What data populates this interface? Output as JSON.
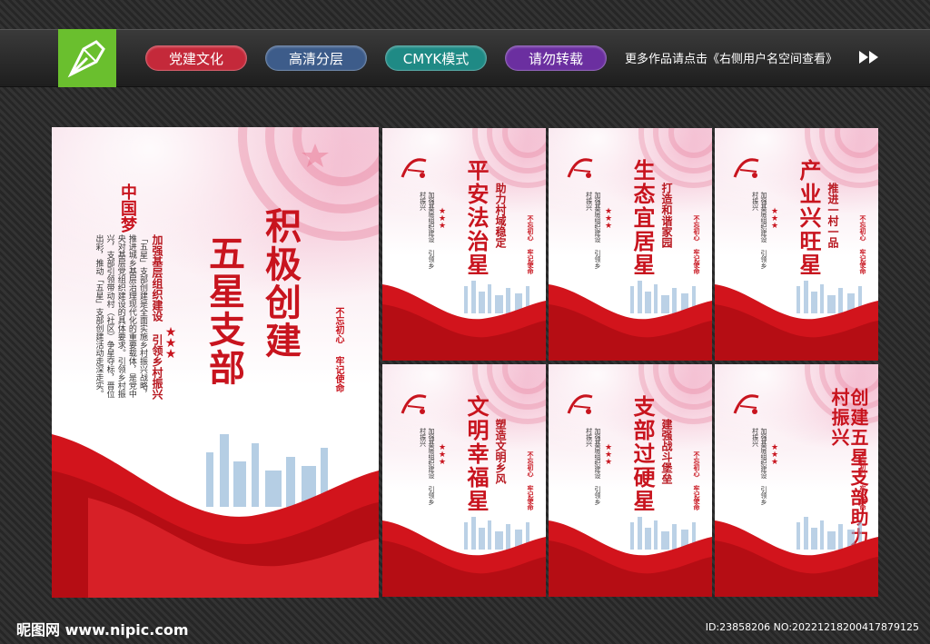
{
  "toolbar": {
    "tags": [
      {
        "label": "党建文化",
        "color": "#c4293a"
      },
      {
        "label": "高清分层",
        "color": "#3d5c8a"
      },
      {
        "label": "CMYK模式",
        "color": "#1f8a85"
      },
      {
        "label": "请勿转载",
        "color": "#6b2fa0"
      }
    ],
    "more_text": "更多作品请点击《右侧用户名空间查看》"
  },
  "colors": {
    "accent": "#c8141e",
    "logo_green": "#6abf2e"
  },
  "main_poster": {
    "logo_text": "中国梦",
    "title_line1": "积极创建",
    "title_line2": "五星支部",
    "sub_title": "加强基层组织建设 引领乡村振兴",
    "body": "「五星」支部创建是全面实施乡村振兴战略，推进城乡基层治理现代化的重要载体，是党中央对基层党组织建设的具体要求。引领乡村振兴，支部引领带动村（社区）争星夺标，晋位出彩，推动「五星」支部创建活动走深走实。",
    "stamp1": "不忘初心",
    "stamp2": "牢记使命"
  },
  "small_posters": [
    {
      "title": "平安法治星",
      "subtitle": "助力村域稳定"
    },
    {
      "title": "生态宜居星",
      "subtitle": "打造和谐家园"
    },
    {
      "title": "产业兴旺星",
      "subtitle": "推进一村一品"
    },
    {
      "title": "文明幸福星",
      "subtitle": "塑造文明乡风"
    },
    {
      "title": "支部过硬星",
      "subtitle": "建强战斗堡垒"
    },
    {
      "title": "创建五星支部助力乡村振兴",
      "subtitle": ""
    }
  ],
  "small_body": "加强基层组织建设 引领乡村振兴",
  "small_stamp": "不忘初心 牢记使命",
  "footer": {
    "site": "昵图网 www.nipic.com",
    "id": "ID:23858206 NO:20221218200417879125"
  }
}
